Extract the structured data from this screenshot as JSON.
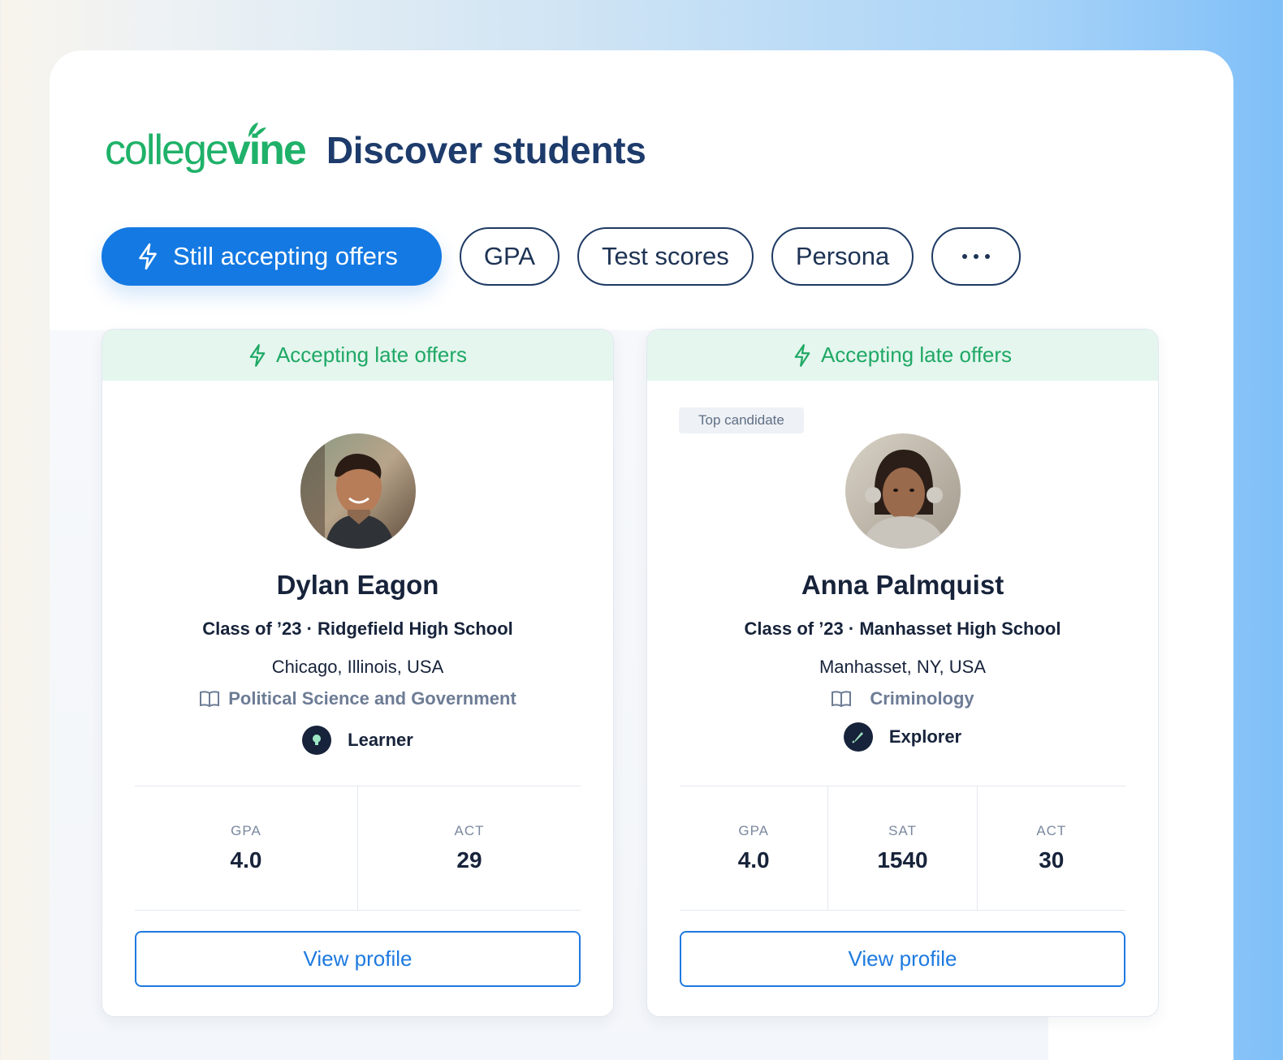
{
  "brand": {
    "logo_part1": "college",
    "logo_part2": "vine",
    "logo_color": "#1fb169"
  },
  "page_title": "Discover students",
  "filters": [
    {
      "label": "Still accepting offers",
      "icon": "bolt-icon",
      "active": true
    },
    {
      "label": "GPA"
    },
    {
      "label": "Test scores"
    },
    {
      "label": "Persona"
    },
    {
      "label": "more",
      "icon": "more-horizontal-icon"
    }
  ],
  "accent_colors": {
    "primary": "#1479e2",
    "success": "#1fa865",
    "navy": "#1d3b6b"
  },
  "students": [
    {
      "banner": "Accepting late offers",
      "badge": "",
      "name": "Dylan Eagon",
      "school_line": "Class of ’23 · Ridgefield High School",
      "location": "Chicago, Illinois, USA",
      "major": "Political Science and Government",
      "persona": "Learner",
      "persona_icon": "lightbulb-icon",
      "stats": [
        {
          "label": "GPA",
          "value": "4.0"
        },
        {
          "label": "ACT",
          "value": "29"
        }
      ],
      "cta": "View profile"
    },
    {
      "banner": "Accepting late offers",
      "badge": "Top candidate",
      "name": "Anna Palmquist",
      "school_line": "Class of ’23 · Manhasset High School",
      "location": "Manhasset, NY, USA",
      "major": "Criminology",
      "persona": "Explorer",
      "persona_icon": "rocket-icon",
      "stats": [
        {
          "label": "GPA",
          "value": "4.0"
        },
        {
          "label": "SAT",
          "value": "1540"
        },
        {
          "label": "ACT",
          "value": "30"
        }
      ],
      "cta": "View profile"
    }
  ]
}
